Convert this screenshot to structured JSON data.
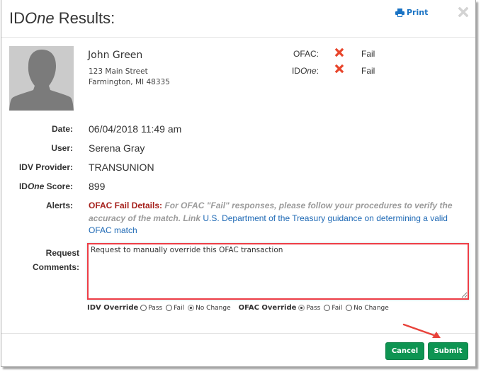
{
  "header": {
    "title_prefix": "ID",
    "title_italic": "One",
    "title_suffix": " Results:",
    "print_label": "Print",
    "print_icon": "print-icon",
    "close_icon": "close-icon"
  },
  "person": {
    "avatar_icon": "person-silhouette-icon",
    "name": "John Green",
    "address_line1": "123 Main Street",
    "address_line2": "Farmington, MI 48335"
  },
  "status": [
    {
      "label_prefix": "OFAC:",
      "label_italic": "",
      "label_suffix": "",
      "icon": "fail-x-icon",
      "value": "Fail"
    },
    {
      "label_prefix": "ID",
      "label_italic": "One",
      "label_suffix": ":",
      "icon": "fail-x-icon",
      "value": "Fail"
    }
  ],
  "colors": {
    "fail": "#e8442a",
    "accent_link": "#1e69b5",
    "button_green": "#0e9452",
    "highlight_red": "#ee3e47",
    "alert_title": "#a5201b"
  },
  "details": {
    "date_label": "Date:",
    "date_value": "06/04/2018 11:49 am",
    "user_label": "User:",
    "user_value": "Serena Gray",
    "provider_label": "IDV Provider:",
    "provider_value": "TRANSUNION",
    "score_label_prefix": "ID",
    "score_label_italic": "One",
    "score_label_suffix": " Score:",
    "score_value": "899",
    "alerts_label": "Alerts:"
  },
  "alert": {
    "title": "OFAC Fail Details:",
    "text": " For OFAC \"Fail\" responses, please follow your procedures to verify the accuracy of the match. Link ",
    "link_text": "U.S. Department of the Treasury guidance on determining a valid OFAC match"
  },
  "comments": {
    "label_line1": "Request",
    "label_line2": "Comments:",
    "value": "Request to manually override this OFAC transaction"
  },
  "overrides": {
    "idv": {
      "label": "IDV Override",
      "options": [
        "Pass",
        "Fail",
        "No Change"
      ],
      "selected": "No Change"
    },
    "ofac": {
      "label": "OFAC Override",
      "options": [
        "Pass",
        "Fail",
        "No Change"
      ],
      "selected": "Pass"
    }
  },
  "footer": {
    "cancel_label": "Cancel",
    "submit_label": "Submit",
    "annotation": "arrow-pointing-to-submit"
  }
}
